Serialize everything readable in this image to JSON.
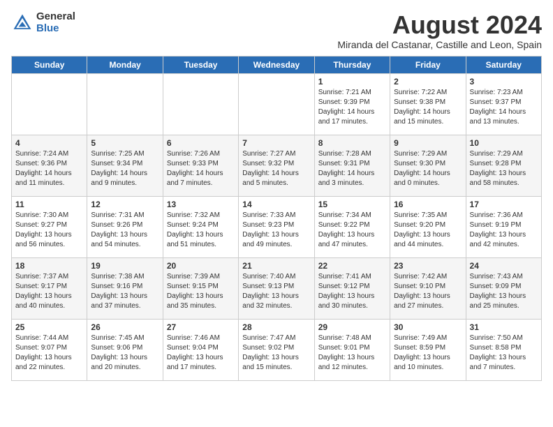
{
  "header": {
    "logo_general": "General",
    "logo_blue": "Blue",
    "month_year": "August 2024",
    "location": "Miranda del Castanar, Castille and Leon, Spain"
  },
  "days_of_week": [
    "Sunday",
    "Monday",
    "Tuesday",
    "Wednesday",
    "Thursday",
    "Friday",
    "Saturday"
  ],
  "weeks": [
    [
      {
        "num": "",
        "info": ""
      },
      {
        "num": "",
        "info": ""
      },
      {
        "num": "",
        "info": ""
      },
      {
        "num": "",
        "info": ""
      },
      {
        "num": "1",
        "info": "Sunrise: 7:21 AM\nSunset: 9:39 PM\nDaylight: 14 hours and 17 minutes."
      },
      {
        "num": "2",
        "info": "Sunrise: 7:22 AM\nSunset: 9:38 PM\nDaylight: 14 hours and 15 minutes."
      },
      {
        "num": "3",
        "info": "Sunrise: 7:23 AM\nSunset: 9:37 PM\nDaylight: 14 hours and 13 minutes."
      }
    ],
    [
      {
        "num": "4",
        "info": "Sunrise: 7:24 AM\nSunset: 9:36 PM\nDaylight: 14 hours and 11 minutes."
      },
      {
        "num": "5",
        "info": "Sunrise: 7:25 AM\nSunset: 9:34 PM\nDaylight: 14 hours and 9 minutes."
      },
      {
        "num": "6",
        "info": "Sunrise: 7:26 AM\nSunset: 9:33 PM\nDaylight: 14 hours and 7 minutes."
      },
      {
        "num": "7",
        "info": "Sunrise: 7:27 AM\nSunset: 9:32 PM\nDaylight: 14 hours and 5 minutes."
      },
      {
        "num": "8",
        "info": "Sunrise: 7:28 AM\nSunset: 9:31 PM\nDaylight: 14 hours and 3 minutes."
      },
      {
        "num": "9",
        "info": "Sunrise: 7:29 AM\nSunset: 9:30 PM\nDaylight: 14 hours and 0 minutes."
      },
      {
        "num": "10",
        "info": "Sunrise: 7:29 AM\nSunset: 9:28 PM\nDaylight: 13 hours and 58 minutes."
      }
    ],
    [
      {
        "num": "11",
        "info": "Sunrise: 7:30 AM\nSunset: 9:27 PM\nDaylight: 13 hours and 56 minutes."
      },
      {
        "num": "12",
        "info": "Sunrise: 7:31 AM\nSunset: 9:26 PM\nDaylight: 13 hours and 54 minutes."
      },
      {
        "num": "13",
        "info": "Sunrise: 7:32 AM\nSunset: 9:24 PM\nDaylight: 13 hours and 51 minutes."
      },
      {
        "num": "14",
        "info": "Sunrise: 7:33 AM\nSunset: 9:23 PM\nDaylight: 13 hours and 49 minutes."
      },
      {
        "num": "15",
        "info": "Sunrise: 7:34 AM\nSunset: 9:22 PM\nDaylight: 13 hours and 47 minutes."
      },
      {
        "num": "16",
        "info": "Sunrise: 7:35 AM\nSunset: 9:20 PM\nDaylight: 13 hours and 44 minutes."
      },
      {
        "num": "17",
        "info": "Sunrise: 7:36 AM\nSunset: 9:19 PM\nDaylight: 13 hours and 42 minutes."
      }
    ],
    [
      {
        "num": "18",
        "info": "Sunrise: 7:37 AM\nSunset: 9:17 PM\nDaylight: 13 hours and 40 minutes."
      },
      {
        "num": "19",
        "info": "Sunrise: 7:38 AM\nSunset: 9:16 PM\nDaylight: 13 hours and 37 minutes."
      },
      {
        "num": "20",
        "info": "Sunrise: 7:39 AM\nSunset: 9:15 PM\nDaylight: 13 hours and 35 minutes."
      },
      {
        "num": "21",
        "info": "Sunrise: 7:40 AM\nSunset: 9:13 PM\nDaylight: 13 hours and 32 minutes."
      },
      {
        "num": "22",
        "info": "Sunrise: 7:41 AM\nSunset: 9:12 PM\nDaylight: 13 hours and 30 minutes."
      },
      {
        "num": "23",
        "info": "Sunrise: 7:42 AM\nSunset: 9:10 PM\nDaylight: 13 hours and 27 minutes."
      },
      {
        "num": "24",
        "info": "Sunrise: 7:43 AM\nSunset: 9:09 PM\nDaylight: 13 hours and 25 minutes."
      }
    ],
    [
      {
        "num": "25",
        "info": "Sunrise: 7:44 AM\nSunset: 9:07 PM\nDaylight: 13 hours and 22 minutes."
      },
      {
        "num": "26",
        "info": "Sunrise: 7:45 AM\nSunset: 9:06 PM\nDaylight: 13 hours and 20 minutes."
      },
      {
        "num": "27",
        "info": "Sunrise: 7:46 AM\nSunset: 9:04 PM\nDaylight: 13 hours and 17 minutes."
      },
      {
        "num": "28",
        "info": "Sunrise: 7:47 AM\nSunset: 9:02 PM\nDaylight: 13 hours and 15 minutes."
      },
      {
        "num": "29",
        "info": "Sunrise: 7:48 AM\nSunset: 9:01 PM\nDaylight: 13 hours and 12 minutes."
      },
      {
        "num": "30",
        "info": "Sunrise: 7:49 AM\nSunset: 8:59 PM\nDaylight: 13 hours and 10 minutes."
      },
      {
        "num": "31",
        "info": "Sunrise: 7:50 AM\nSunset: 8:58 PM\nDaylight: 13 hours and 7 minutes."
      }
    ]
  ]
}
